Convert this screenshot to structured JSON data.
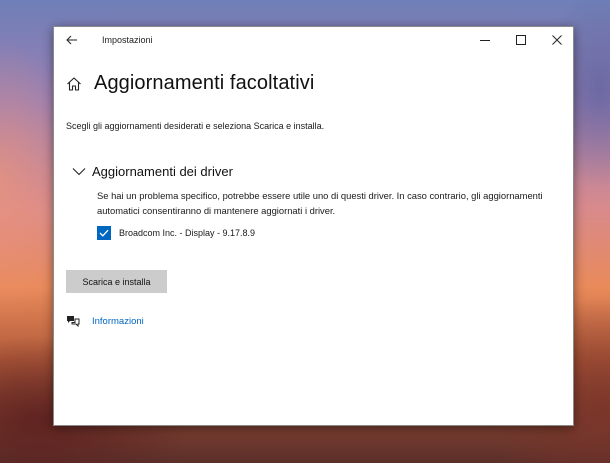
{
  "window": {
    "title": "Impostazioni"
  },
  "page": {
    "title": "Aggiornamenti facoltativi",
    "description": "Scegli gli aggiornamenti desiderati e seleziona Scarica e installa."
  },
  "driver_section": {
    "title": "Aggiornamenti dei driver",
    "expanded": true,
    "description": "Se hai un problema specifico, potrebbe essere utile uno di questi driver. In caso contrario, gli aggiornamenti automatici consentiranno di mantenere aggiornati i driver.",
    "items": [
      {
        "label": "Broadcom Inc. - Display - 9.17.8.9",
        "checked": true
      }
    ]
  },
  "actions": {
    "install_label": "Scarica e installa"
  },
  "links": {
    "info_label": "Informazioni"
  },
  "icons": {
    "back": "arrow-left-icon",
    "minimize": "minimize-icon",
    "maximize": "maximize-icon",
    "close": "close-icon",
    "home": "home-icon",
    "chevron": "chevron-down-icon",
    "checkbox": "checkmark-icon",
    "info": "chat-bubbles-icon"
  },
  "colors": {
    "accent": "#0067c0",
    "button_bg": "#cccccc",
    "window_bg": "#ffffff"
  }
}
